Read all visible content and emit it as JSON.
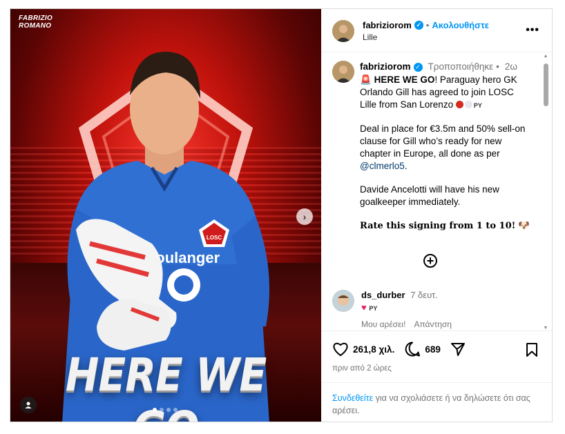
{
  "media": {
    "watermark": "FABRIZIO\nROMANO",
    "headline": "HERE WE GO",
    "jersey_sponsor": "boulanger",
    "crest_text": "LOSC",
    "slide_count": 4,
    "active_slide": 1
  },
  "header": {
    "username": "fabriziorom",
    "separator": "•",
    "follow_label": "Ακολουθήστε",
    "location": "Lille"
  },
  "caption": {
    "username": "fabriziorom",
    "edited_label": "Τροποποιήθηκε",
    "dot": "•",
    "time": "2ω",
    "emoji_siren": "🚨",
    "here_we_go": "HERE WE GO",
    "line1_rest": "! Paraguay hero GK Orlando Gill has agreed to join LOSC Lille from San Lorenzo",
    "py_label": "PY",
    "para2": "Deal in place for €3.5m and 50% sell-on clause for Gill who’s ready for new chapter in Europe, all done as per",
    "mention": "@clmerlo5",
    "para2_end": ".",
    "para3": "Davide Ancelotti will have his new goalkeeper immediately.",
    "rate": "Rate this signing from 1 to 10",
    "rate_end": "!",
    "emoji_dog": "🐶"
  },
  "comment": {
    "username": "ds_durber",
    "time": "7 δευτ.",
    "heart": "♥",
    "py_label": "PY",
    "like_label": "Μου αρέσει!",
    "reply_label": "Απάντηση"
  },
  "stats": {
    "likes": "261,8 χιλ.",
    "comments": "689",
    "date": "πριν από 2 ώρες"
  },
  "login": {
    "link": "Συνδεθείτε",
    "text": " για να σχολιάσετε ή να δηλώσετε ότι σας αρέσει."
  },
  "colors": {
    "accent": "#0095f6",
    "mention": "#00376b",
    "muted": "#737373",
    "lille_red": "#d01c1c",
    "jersey_blue": "#2a66c9"
  },
  "icons": [
    "verified-badge-icon",
    "more-options-icon",
    "plus-circle-icon",
    "heart-icon",
    "comment-icon",
    "share-icon",
    "bookmark-icon",
    "chevron-right-icon",
    "user-tag-icon"
  ]
}
